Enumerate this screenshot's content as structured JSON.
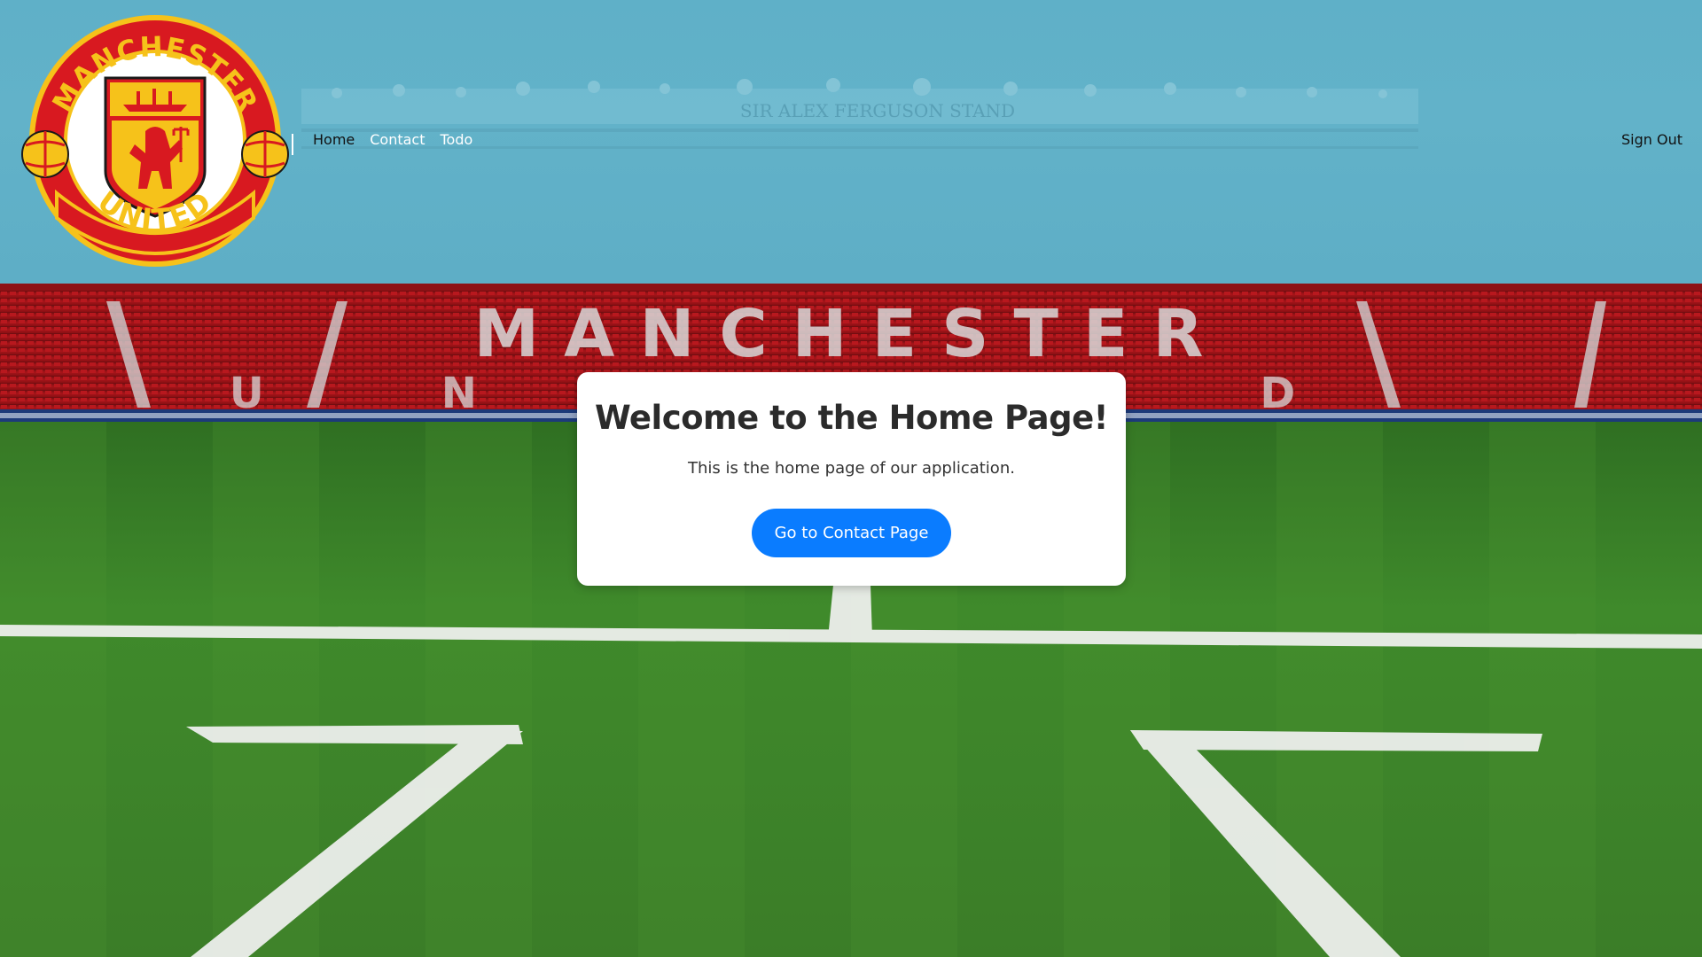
{
  "header": {
    "nav": [
      {
        "label": "Home"
      },
      {
        "label": "Contact"
      },
      {
        "label": "Todo"
      }
    ],
    "sign_out": "Sign Out",
    "logo": {
      "top_text": "MANCHESTER",
      "bottom_text": "UNITED",
      "icon": "manchester-united-crest"
    },
    "banner_text": "SIR ALEX FERGUSON STAND"
  },
  "stadium": {
    "seat_text": "MANCHESTER UNITED"
  },
  "card": {
    "title": "Welcome to the Home Page!",
    "subtitle": "This is the home page of our application.",
    "button": "Go to Contact Page"
  },
  "colors": {
    "header_bg": "#5fb0c8",
    "button_bg": "#0a7cff",
    "crest_red": "#d81920",
    "crest_gold": "#f6c21a"
  }
}
